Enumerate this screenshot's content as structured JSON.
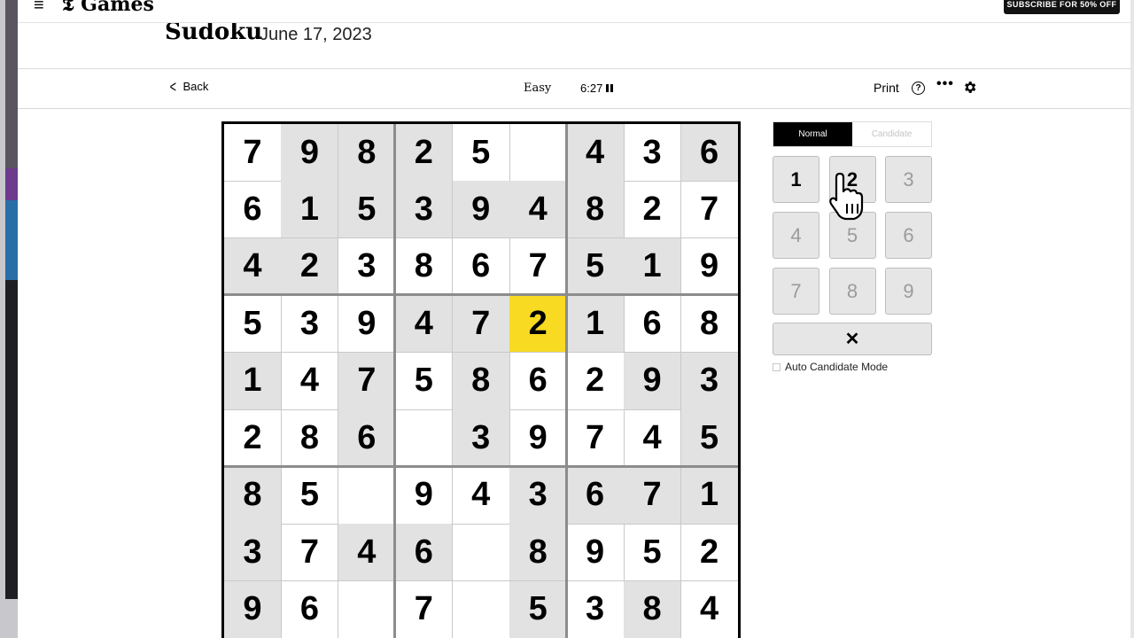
{
  "header": {
    "brand": "Games",
    "subscribe_label": "SUBSCRIBE FOR 50% OFF"
  },
  "title": {
    "game": "Sudoku",
    "date": "June 17, 2023"
  },
  "toolbar": {
    "back_label": "Back",
    "difficulty": "Easy",
    "timer": "6:27",
    "print_label": "Print",
    "help_symbol": "?",
    "more_symbol": "•••"
  },
  "board": {
    "rows": [
      [
        "7",
        "9",
        "8",
        "2",
        "5",
        "",
        "4",
        "3",
        "6"
      ],
      [
        "6",
        "1",
        "5",
        "3",
        "9",
        "4",
        "8",
        "2",
        "7"
      ],
      [
        "4",
        "2",
        "3",
        "8",
        "6",
        "7",
        "5",
        "1",
        "9"
      ],
      [
        "5",
        "3",
        "9",
        "4",
        "7",
        "2",
        "1",
        "6",
        "8"
      ],
      [
        "1",
        "4",
        "7",
        "5",
        "8",
        "6",
        "2",
        "9",
        "3"
      ],
      [
        "2",
        "8",
        "6",
        "",
        "3",
        "9",
        "7",
        "4",
        "5"
      ],
      [
        "8",
        "5",
        "",
        "9",
        "4",
        "3",
        "6",
        "7",
        "1"
      ],
      [
        "3",
        "7",
        "4",
        "6",
        "",
        "8",
        "9",
        "5",
        "2"
      ],
      [
        "9",
        "6",
        "",
        "7",
        "",
        "5",
        "3",
        "8",
        "4"
      ]
    ],
    "shaded": [
      [
        0,
        1
      ],
      [
        0,
        2
      ],
      [
        0,
        3
      ],
      [
        0,
        6
      ],
      [
        0,
        8
      ],
      [
        1,
        1
      ],
      [
        1,
        2
      ],
      [
        1,
        3
      ],
      [
        1,
        4
      ],
      [
        1,
        5
      ],
      [
        1,
        6
      ],
      [
        2,
        0
      ],
      [
        2,
        1
      ],
      [
        2,
        6
      ],
      [
        2,
        7
      ],
      [
        3,
        3
      ],
      [
        3,
        4
      ],
      [
        3,
        6
      ],
      [
        4,
        0
      ],
      [
        4,
        2
      ],
      [
        4,
        4
      ],
      [
        4,
        7
      ],
      [
        4,
        8
      ],
      [
        5,
        2
      ],
      [
        5,
        4
      ],
      [
        5,
        8
      ],
      [
        6,
        0
      ],
      [
        6,
        5
      ],
      [
        6,
        6
      ],
      [
        6,
        7
      ],
      [
        6,
        8
      ],
      [
        7,
        0
      ],
      [
        7,
        2
      ],
      [
        7,
        3
      ],
      [
        7,
        5
      ],
      [
        8,
        0
      ],
      [
        8,
        5
      ],
      [
        8,
        7
      ]
    ],
    "selected": [
      3,
      5
    ]
  },
  "panel": {
    "mode_normal": "Normal",
    "mode_candidate": "Candidate",
    "keys": [
      "1",
      "2",
      "3",
      "4",
      "5",
      "6",
      "7",
      "8",
      "9"
    ],
    "enabled_keys": [
      "1",
      "2"
    ],
    "erase_symbol": "✕",
    "auto_candidate_label": "Auto Candidate Mode"
  },
  "icons": {
    "menu": "hamburger-icon",
    "back": "chevron-left-icon",
    "pause": "pause-icon",
    "help": "question-circle-icon",
    "more": "ellipsis-icon",
    "settings": "gear-icon",
    "cursor": "hand-pointer-cursor"
  },
  "colors": {
    "selected_cell": "#f7da21",
    "shaded_cell": "#e2e2e2",
    "key_bg": "#e6e6e6",
    "active_mode": "#000000"
  }
}
